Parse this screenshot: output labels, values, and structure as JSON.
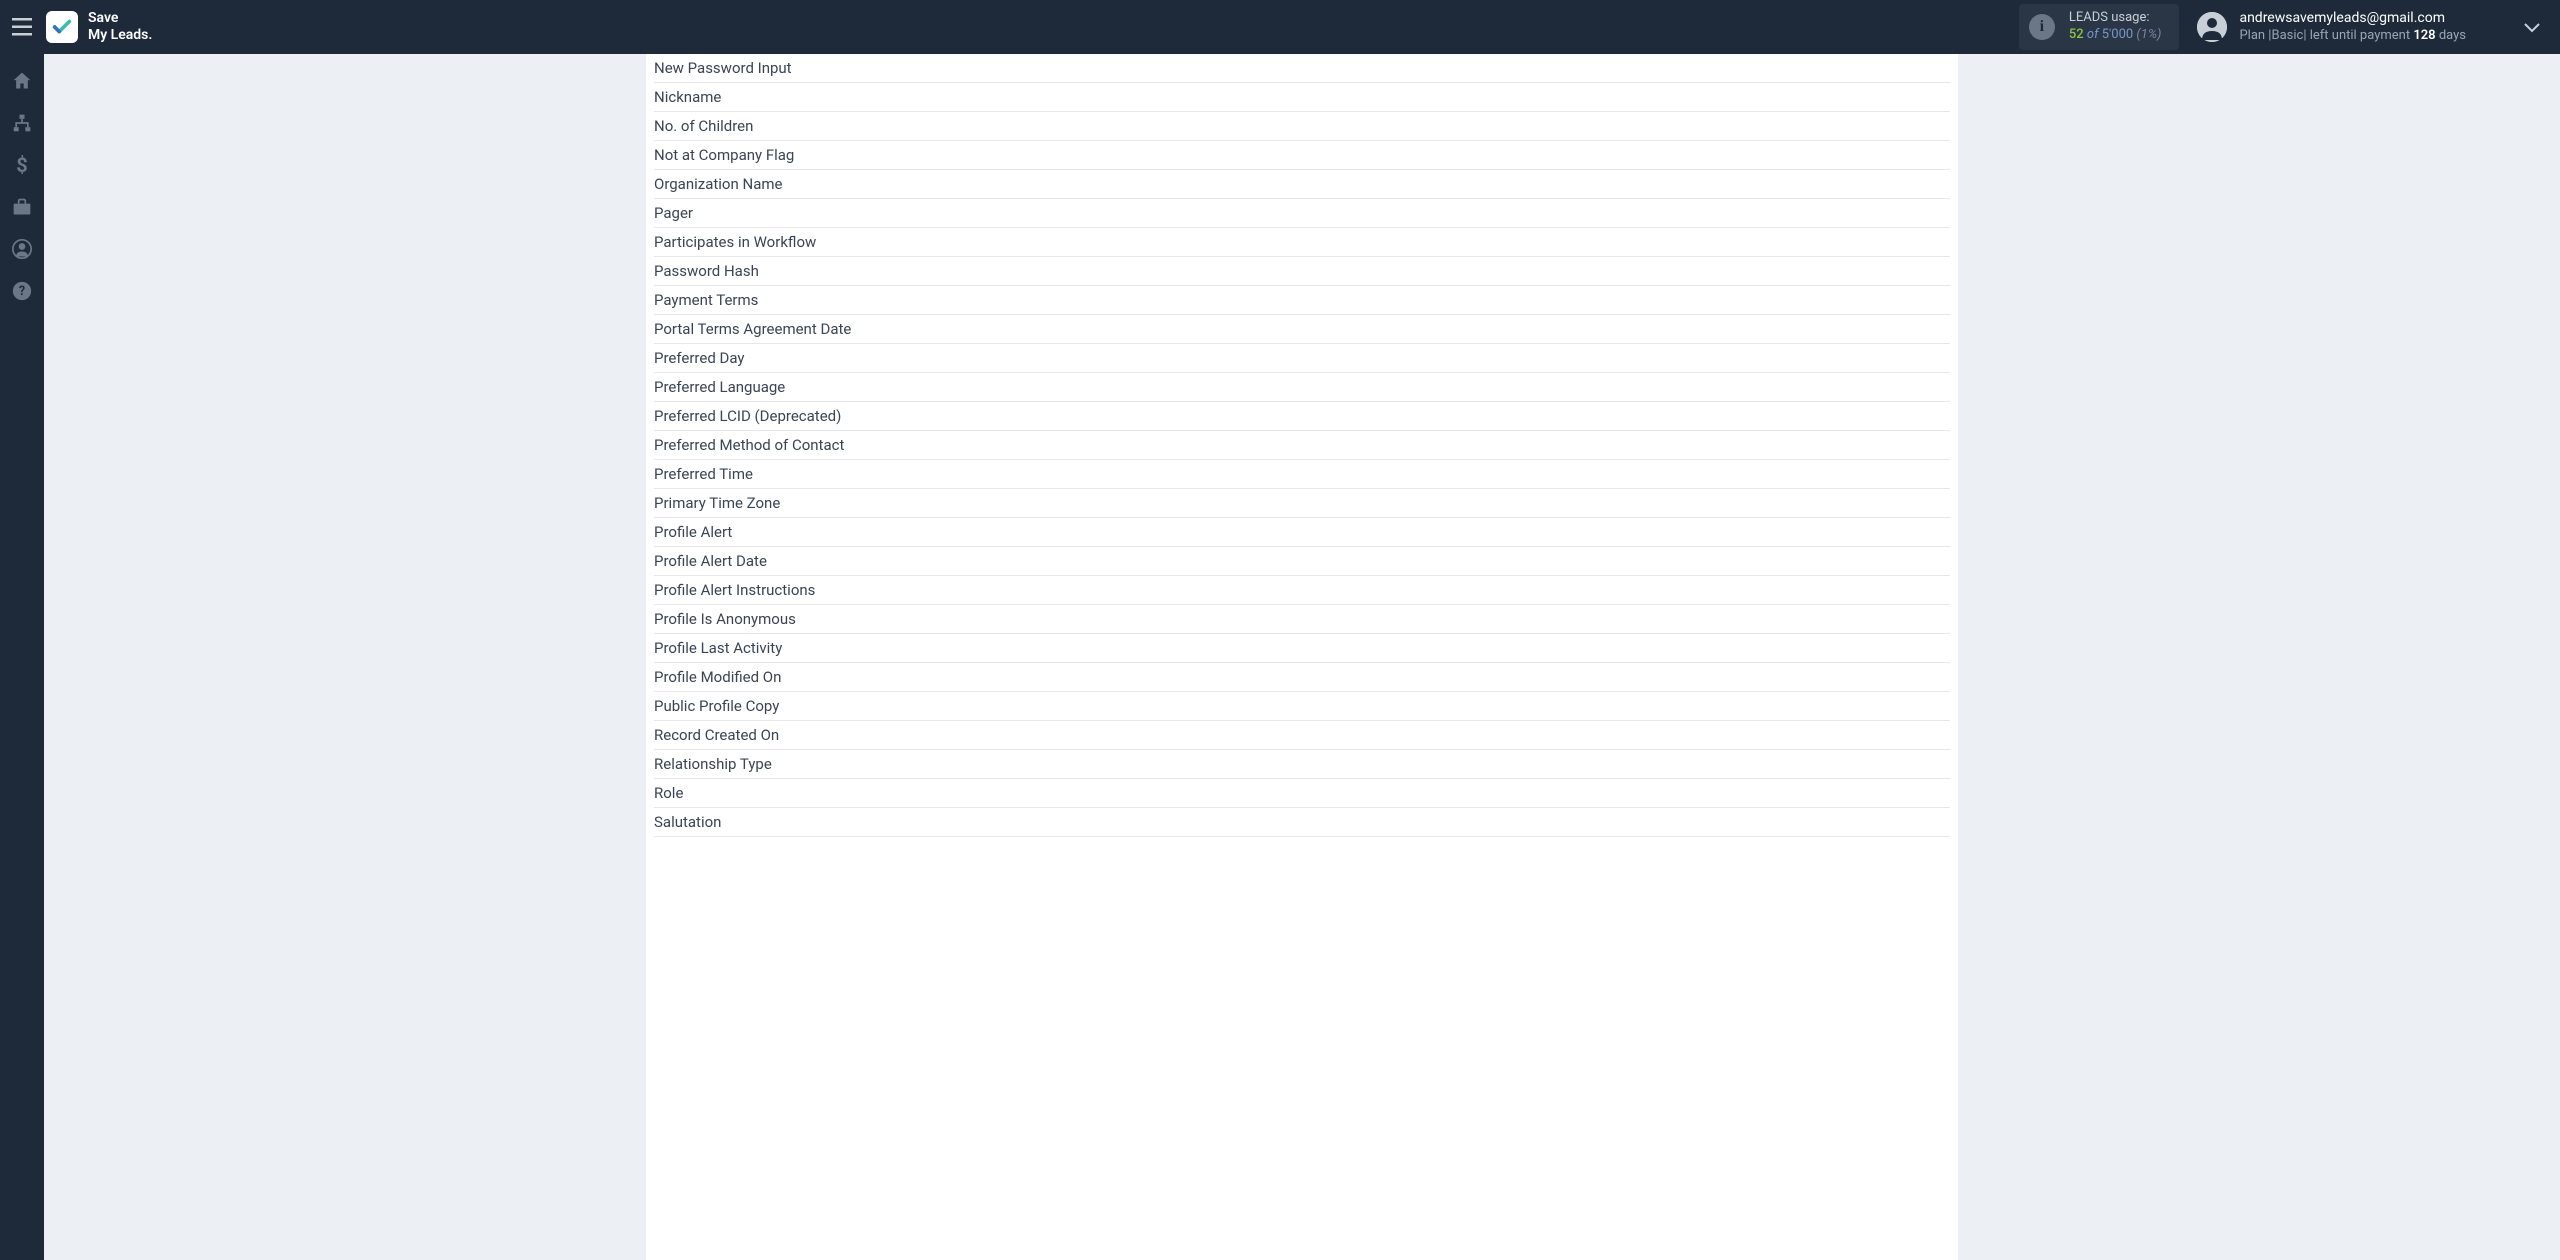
{
  "header": {
    "logo_line1": "Save",
    "logo_line2": "My Leads.",
    "usage": {
      "label": "LEADS usage:",
      "value": "52",
      "of": "of",
      "max": "5'000",
      "pct": "(1%)"
    },
    "user": {
      "email": "andrewsavemyleads@gmail.com",
      "plan_prefix": "Plan |",
      "plan_name": "Basic",
      "plan_mid": "| left until payment ",
      "plan_days": "128",
      "plan_suffix": " days"
    }
  },
  "fields": [
    "New Password Input",
    "Nickname",
    "No. of Children",
    "Not at Company Flag",
    "Organization Name",
    "Pager",
    "Participates in Workflow",
    "Password Hash",
    "Payment Terms",
    "Portal Terms Agreement Date",
    "Preferred Day",
    "Preferred Language",
    "Preferred LCID (Deprecated)",
    "Preferred Method of Contact",
    "Preferred Time",
    "Primary Time Zone",
    "Profile Alert",
    "Profile Alert Date",
    "Profile Alert Instructions",
    "Profile Is Anonymous",
    "Profile Last Activity",
    "Profile Modified On",
    "Public Profile Copy",
    "Record Created On",
    "Relationship Type",
    "Role",
    "Salutation"
  ]
}
